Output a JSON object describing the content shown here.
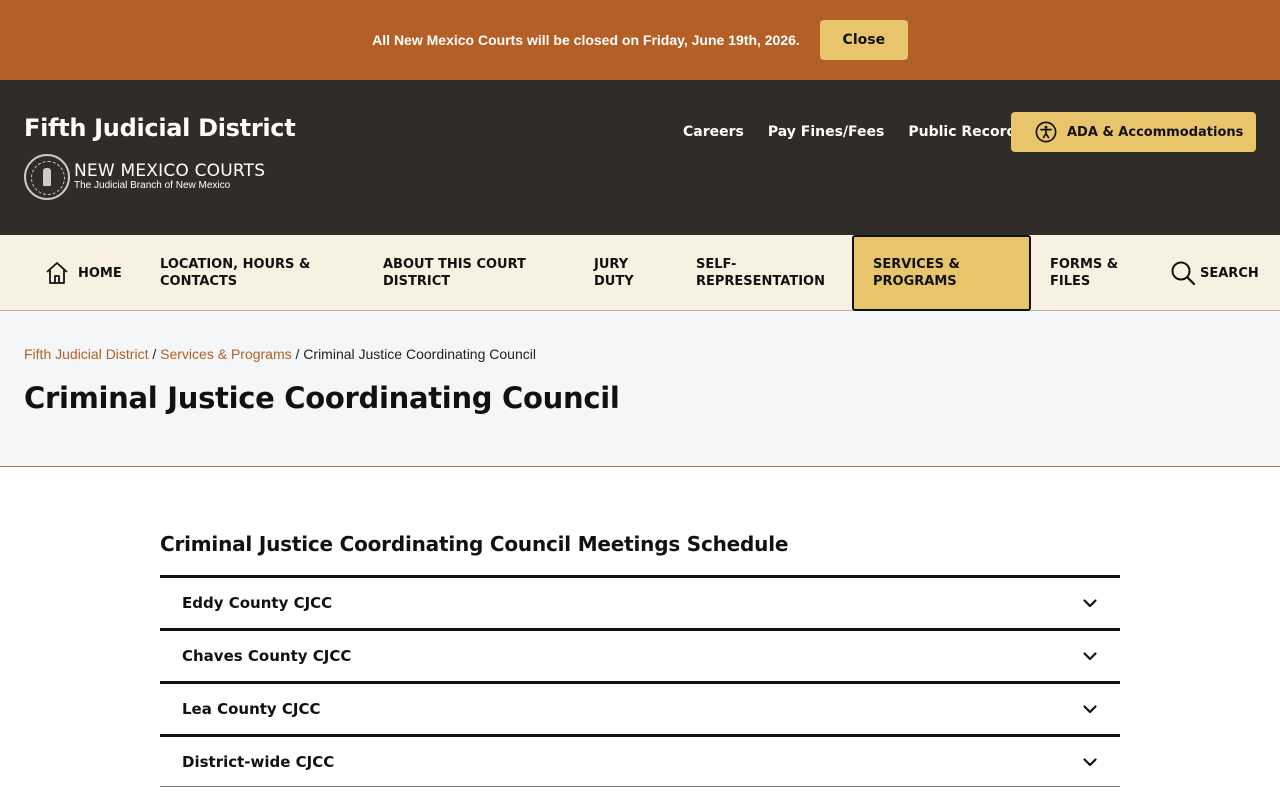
{
  "alert": {
    "message": "All New Mexico Courts will be closed on Friday, June 19th, 2026.",
    "close_label": "Close"
  },
  "header": {
    "site_name": "Fifth Judicial District",
    "logo_main": "NEW MEXICO COURTS",
    "logo_sub": "The Judicial Branch of New Mexico",
    "utility_links": [
      "Careers",
      "Pay Fines/Fees",
      "Public Records"
    ],
    "ada_label": "ADA & Accommodations"
  },
  "nav": {
    "home": "HOME",
    "location_1": "LOCATION, HOURS &",
    "location_2": "CONTACTS",
    "about_1": "ABOUT THIS COURT",
    "about_2": "DISTRICT",
    "jury_1": "JURY",
    "jury_2": "DUTY",
    "self_1": "SELF-",
    "self_2": "REPRESENTATION",
    "services_1": "SERVICES &",
    "services_2": "PROGRAMS",
    "forms_1": "FORMS &",
    "forms_2": "FILES",
    "search": "SEARCH"
  },
  "breadcrumb": {
    "home": "Fifth Judicial District",
    "section": "Services & Programs",
    "current": "Criminal Justice Coordinating Council",
    "separator": "/"
  },
  "page": {
    "title": "Criminal Justice Coordinating Council",
    "section_title": "Criminal Justice Coordinating Council Meetings Schedule"
  },
  "accordion": [
    "Eddy County CJCC",
    "Chaves County CJCC",
    "Lea County CJCC",
    "District-wide CJCC"
  ],
  "colors": {
    "alert_bg": "#b45f26",
    "header_bg": "#302c28",
    "accent": "#e8c46a",
    "nav_bg": "#f8f0e1",
    "link": "#b45f26"
  },
  "icons": {
    "ada": "accessibility-icon",
    "home": "home-icon",
    "search": "search-icon",
    "accordion": "chevron-down-icon"
  }
}
